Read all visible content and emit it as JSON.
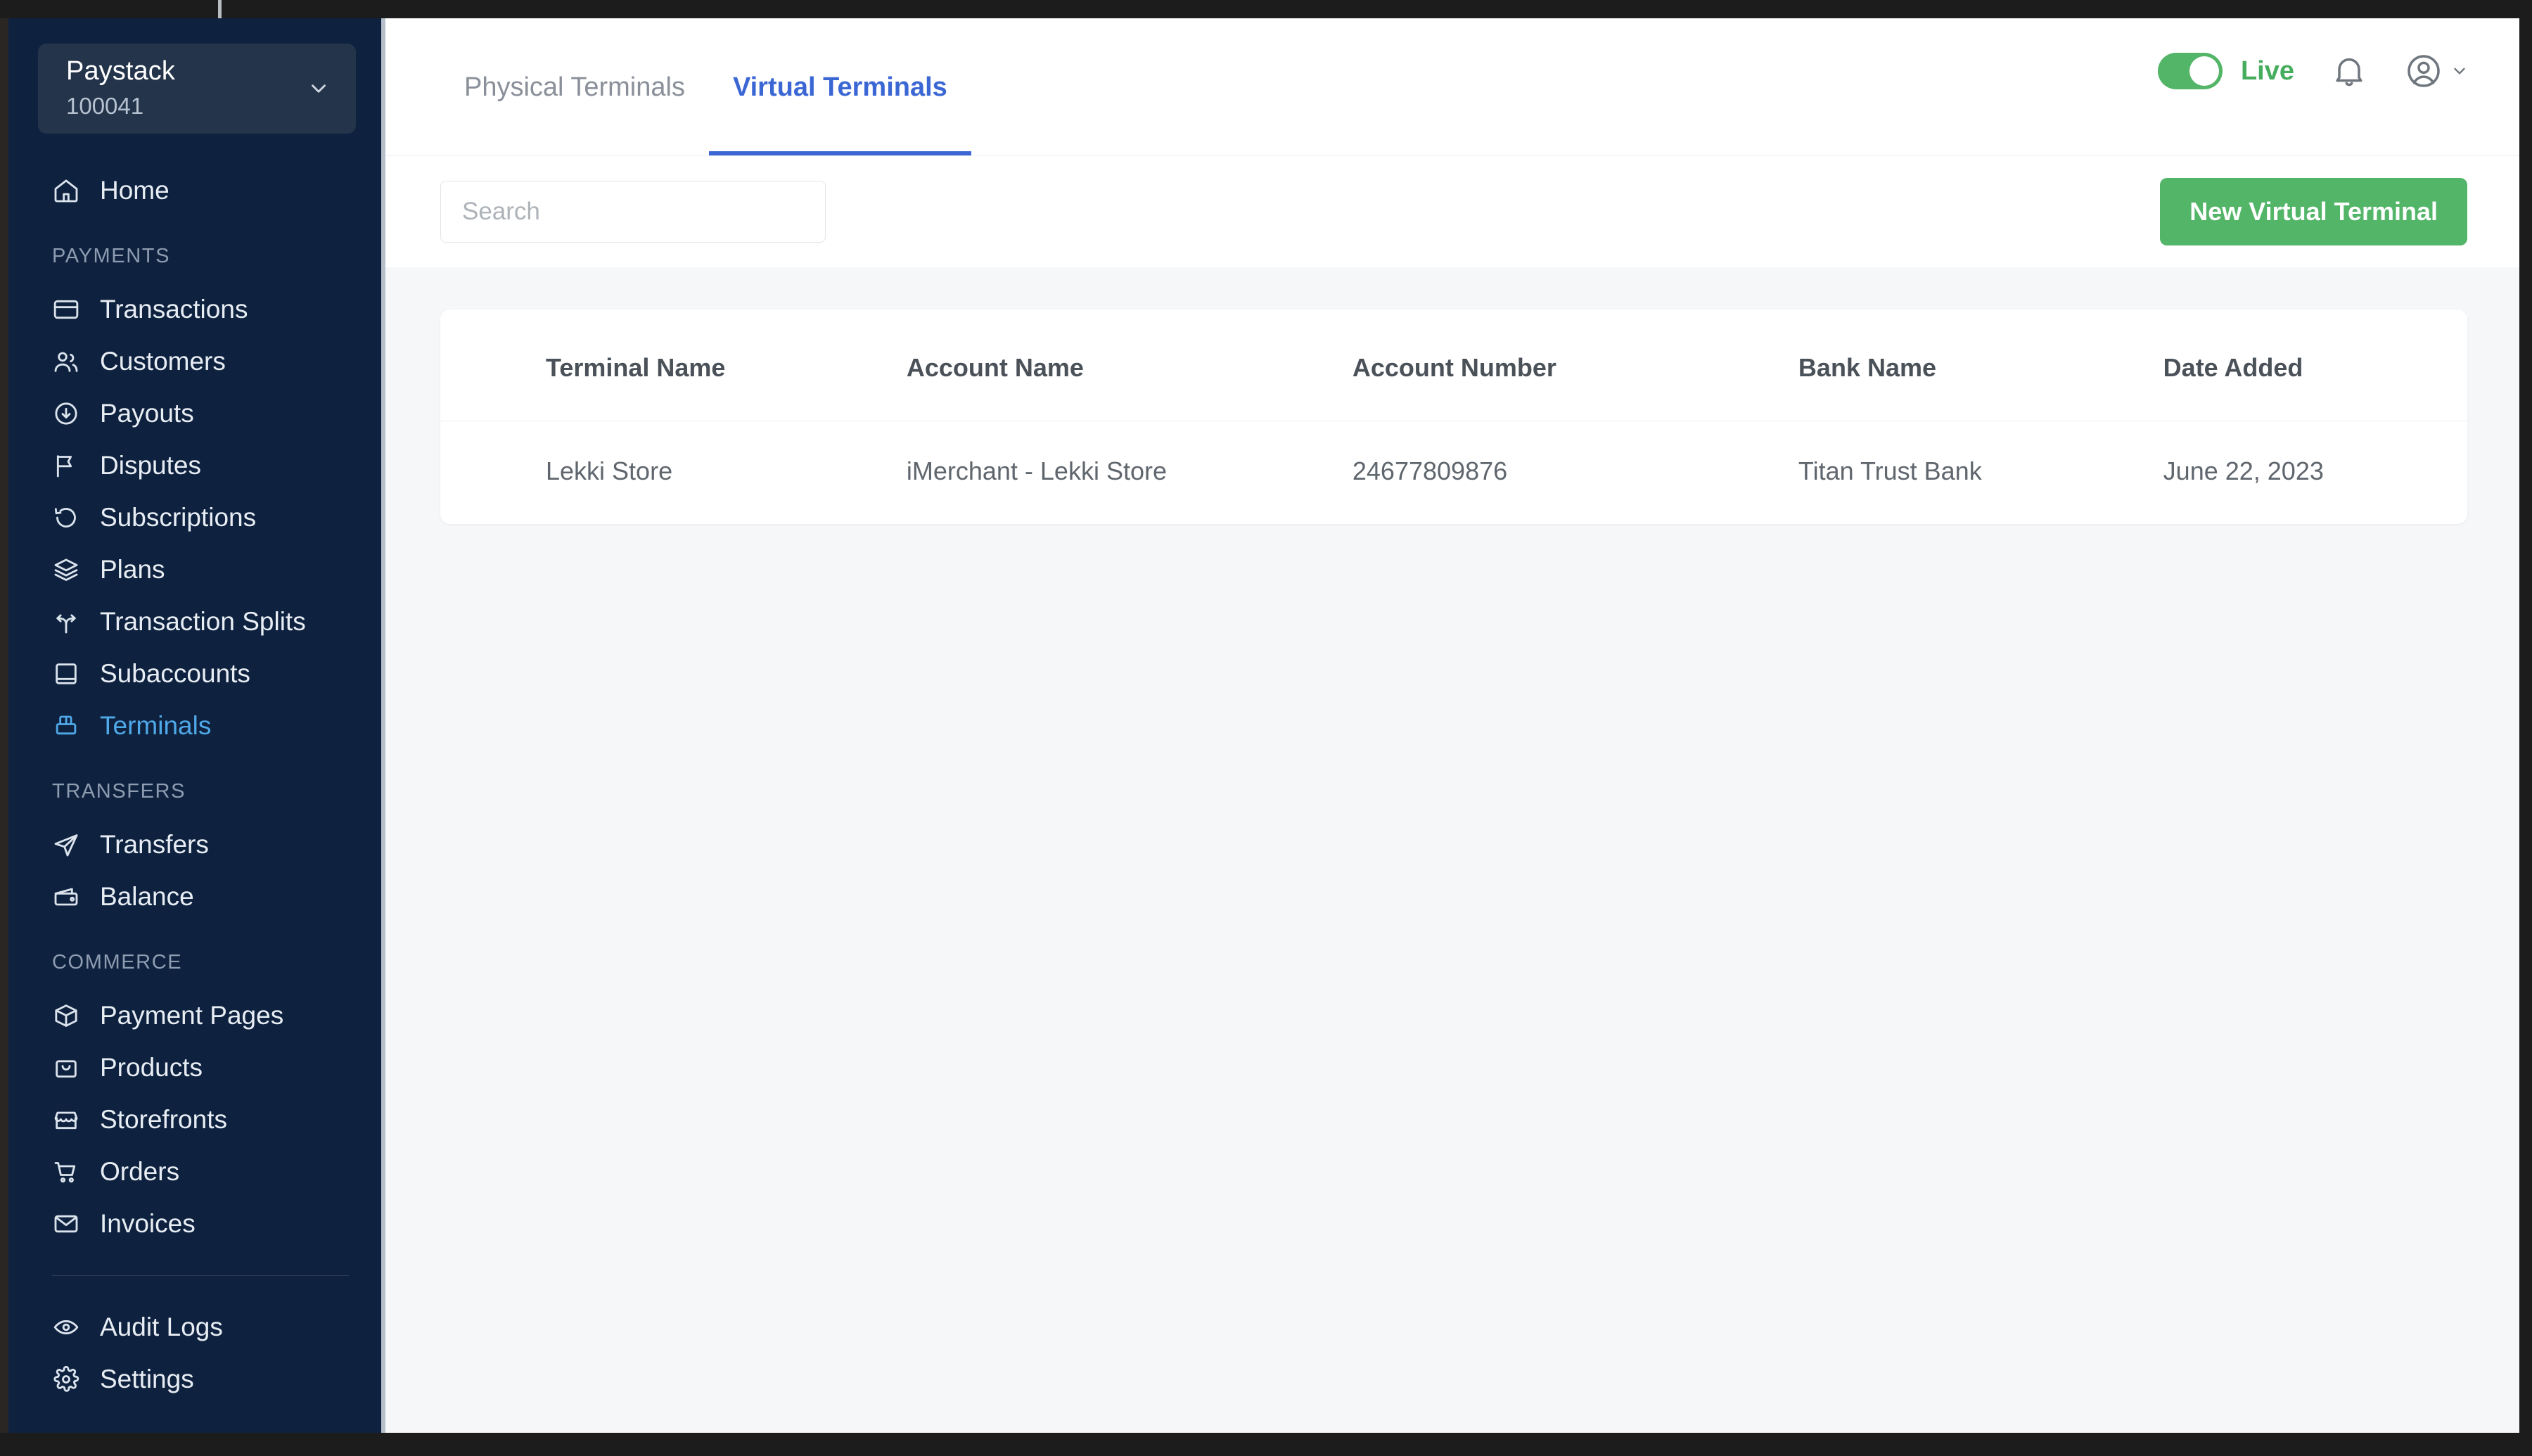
{
  "account_switcher": {
    "name": "Paystack",
    "id": "100041",
    "chevron_icon": "chevron-down-icon"
  },
  "sidebar": {
    "home": {
      "label": "Home",
      "icon": "home-icon"
    },
    "sections": [
      {
        "label": "PAYMENTS",
        "items": [
          {
            "label": "Transactions",
            "icon": "credit-card-icon",
            "active": false
          },
          {
            "label": "Customers",
            "icon": "users-icon",
            "active": false
          },
          {
            "label": "Payouts",
            "icon": "download-circle-icon",
            "active": false
          },
          {
            "label": "Disputes",
            "icon": "flag-icon",
            "active": false
          },
          {
            "label": "Subscriptions",
            "icon": "refresh-icon",
            "active": false
          },
          {
            "label": "Plans",
            "icon": "layers-icon",
            "active": false
          },
          {
            "label": "Transaction Splits",
            "icon": "split-arrows-icon",
            "active": false
          },
          {
            "label": "Subaccounts",
            "icon": "book-icon",
            "active": false
          },
          {
            "label": "Terminals",
            "icon": "terminal-pos-icon",
            "active": true
          }
        ]
      },
      {
        "label": "TRANSFERS",
        "items": [
          {
            "label": "Transfers",
            "icon": "send-icon",
            "active": false
          },
          {
            "label": "Balance",
            "icon": "wallet-icon",
            "active": false
          }
        ]
      },
      {
        "label": "COMMERCE",
        "items": [
          {
            "label": "Payment Pages",
            "icon": "box-icon",
            "active": false
          },
          {
            "label": "Products",
            "icon": "basket-icon",
            "active": false
          },
          {
            "label": "Storefronts",
            "icon": "store-icon",
            "active": false
          },
          {
            "label": "Orders",
            "icon": "shopping-cart-icon",
            "active": false
          },
          {
            "label": "Invoices",
            "icon": "envelope-icon",
            "active": false
          }
        ]
      }
    ],
    "footer_items": [
      {
        "label": "Audit Logs",
        "icon": "eye-icon",
        "active": false
      },
      {
        "label": "Settings",
        "icon": "gear-icon",
        "active": false
      }
    ]
  },
  "topbar": {
    "tabs": [
      {
        "label": "Physical Terminals",
        "active": false
      },
      {
        "label": "Virtual Terminals",
        "active": true
      }
    ],
    "mode_toggle": {
      "label": "Live",
      "on": true,
      "color": "#52b567"
    },
    "notifications_icon": "bell-icon",
    "account_icon": "user-circle-icon",
    "account_chevron_icon": "chevron-down-icon"
  },
  "toolbar": {
    "search": {
      "value": "",
      "placeholder": "Search"
    },
    "new_terminal_label": "New Virtual Terminal"
  },
  "table": {
    "columns": [
      "Terminal Name",
      "Account Name",
      "Account Number",
      "Bank Name",
      "Date Added"
    ],
    "rows": [
      {
        "terminal_name": "Lekki Store",
        "account_name": "iMerchant - Lekki Store",
        "account_number": "24677809876",
        "bank_name": "Titan Trust Bank",
        "date_added": "June 22, 2023"
      }
    ]
  },
  "colors": {
    "sidebar_bg": "#0e2240",
    "sidebar_active": "#4fa8e8",
    "tab_active": "#3b67d4",
    "green": "#52b567",
    "page_bg": "#f6f7f8"
  }
}
